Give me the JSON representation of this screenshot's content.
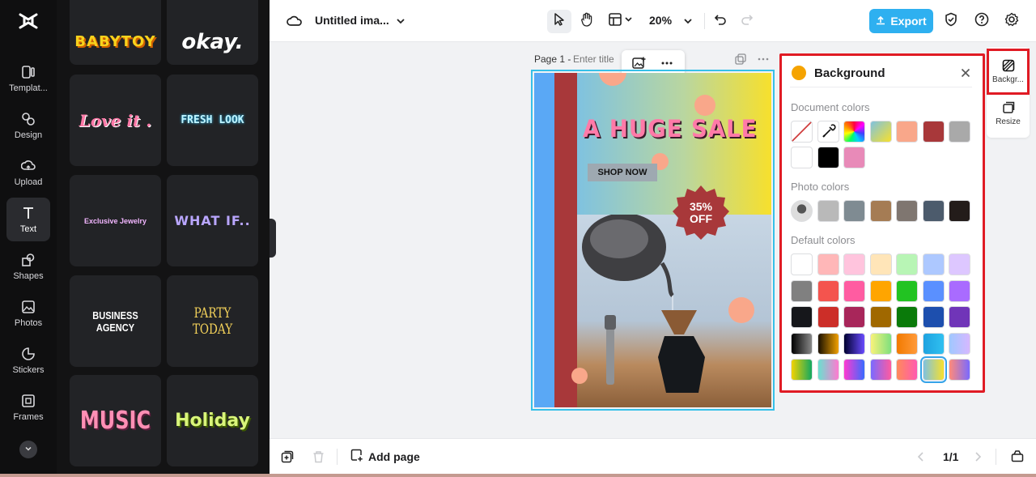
{
  "app": {
    "title": "Untitled ima...",
    "zoom": "20%",
    "export_label": "Export"
  },
  "rail": {
    "items": [
      {
        "label": "Templat...",
        "icon": "templates-icon"
      },
      {
        "label": "Design",
        "icon": "design-icon"
      },
      {
        "label": "Upload",
        "icon": "upload-icon"
      },
      {
        "label": "Text",
        "icon": "text-icon",
        "active": true
      },
      {
        "label": "Shapes",
        "icon": "shapes-icon"
      },
      {
        "label": "Photos",
        "icon": "photos-icon"
      },
      {
        "label": "Stickers",
        "icon": "stickers-icon"
      },
      {
        "label": "Frames",
        "icon": "frames-icon"
      }
    ]
  },
  "text_panel": {
    "styles": [
      {
        "text": "BABYTOY",
        "color": "#f8d21c"
      },
      {
        "text": "okay.",
        "color": "#ffffff"
      },
      {
        "text": "Love it .",
        "color": "#ff7aa8"
      },
      {
        "text": "FRESH LOOK",
        "color": "#bff4ff"
      },
      {
        "text": "Exclusive Jewelry",
        "color": "#f2b6ff"
      },
      {
        "text": "WHAT IF..",
        "color": "#b9a6ff"
      },
      {
        "text": "BUSINESS AGENCY",
        "color": "#ffffff"
      },
      {
        "text": "PARTY TODAY",
        "color": "#f4d25a"
      },
      {
        "text": "MUSIC",
        "color": "#ff8fb5"
      },
      {
        "text": "Holiday",
        "color": "#d9f57a"
      }
    ]
  },
  "page": {
    "label": "Page 1 -",
    "title_placeholder": "Enter title"
  },
  "design": {
    "headline": "A HUGE SALE",
    "cta": "SHOP NOW",
    "badge_line1": "35%",
    "badge_line2": "OFF",
    "colors": {
      "stripe_blue": "#5aa8f5",
      "stripe_red": "#a8383a",
      "gradient_start": "#7fc2e0",
      "gradient_end": "#f7e02c",
      "circle": "#f9a78a",
      "badge": "#a8383a",
      "headline": "#ff7aa8"
    }
  },
  "background_panel": {
    "title": "Background",
    "document_colors_title": "Document colors",
    "photo_colors_title": "Photo colors",
    "default_colors_title": "Default colors",
    "document_colors": [
      "none",
      "picker",
      "rainbow",
      "linear-gradient(135deg,#7fc2e0,#f7e02c)",
      "#f9a78a",
      "#a8383a",
      "#a9a9a9",
      "#ffffff",
      "#000000",
      "#e88ab8"
    ],
    "photo_colors": [
      "photo",
      "#b9b9b9",
      "#7f8b92",
      "#a57c54",
      "#7f7670",
      "#4c5b6c",
      "#231c1a"
    ],
    "default_colors": [
      [
        "#ffffff",
        "#ffb7b8",
        "#ffc4dd",
        "#ffe5b8",
        "#b8f5b5",
        "#adc8ff",
        "#ddc7ff"
      ],
      [
        "#808080",
        "#f4544e",
        "#ff5ca1",
        "#ffa500",
        "#22c322",
        "#5a90ff",
        "#a96bff"
      ],
      [
        "#16171b",
        "#cc2e28",
        "#a8265a",
        "#a06800",
        "#0a7a0a",
        "#1d4fae",
        "#7035b8"
      ],
      [
        "linear-gradient(90deg,#000,#888)",
        "linear-gradient(90deg,#1a1000,#f0a000)",
        "linear-gradient(90deg,#000030,#6a4cff)",
        "linear-gradient(90deg,#f8f27a,#7ee07e)",
        "linear-gradient(90deg,#f27a00,#ff9a3a)",
        "linear-gradient(90deg,#1ea2e0,#30c0f0)",
        "linear-gradient(90deg,#a0c8ff,#d6b8ff)"
      ],
      [
        "linear-gradient(90deg,#f2d200,#12a860)",
        "linear-gradient(90deg,#6ae0d0,#ff7ad0)",
        "linear-gradient(90deg,#ff3ad0,#3a6aff)",
        "linear-gradient(90deg,#7a6aff,#ff5aa0)",
        "linear-gradient(90deg,#ff8a5a,#ff5ab0)",
        "linear-gradient(90deg,#7fc2e0,#f7e02c)",
        "linear-gradient(90deg,#ff8a7a,#7a6aff)"
      ]
    ],
    "selected_default": [
      4,
      5
    ]
  },
  "right_rail": {
    "items": [
      {
        "label": "Backgr...",
        "icon": "background-icon"
      },
      {
        "label": "Resize",
        "icon": "resize-icon"
      }
    ]
  },
  "bottom": {
    "add_page_label": "Add page",
    "pager": "1/1"
  }
}
